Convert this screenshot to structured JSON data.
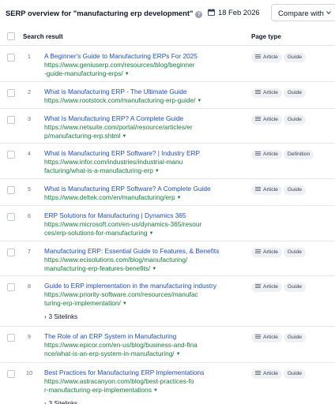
{
  "header": {
    "title": "SERP overview for \"manufacturing erp development\"",
    "date": "18 Feb 2026",
    "compare_label": "Compare with"
  },
  "table": {
    "col_result": "Search result",
    "col_pagetype": "Page type"
  },
  "sitelinks_label": "3 Sitelinks",
  "rows": [
    {
      "rank": "1",
      "title": "A Beginner's Guide to Manufacturing ERPs For 2025",
      "url": "https://www.geniuserp.com/resources/blog/beginner-guide-manufacturing-erps/",
      "tags": [
        "Article",
        "Guide"
      ]
    },
    {
      "rank": "2",
      "title": "What is Manufacturing ERP - The Ultimate Guide",
      "url": "https://www.rootstock.com/manufacturing-erp-guide/",
      "tags": [
        "Article",
        "Guide"
      ]
    },
    {
      "rank": "3",
      "title": "What Is Manufacturing ERP? A Complete Guide",
      "url": "https://www.netsuite.com/portal/resource/articles/erp/manufacturing-erp.shtml",
      "tags": [
        "Article",
        "Guide"
      ]
    },
    {
      "rank": "4",
      "title": "What is Manufacturing ERP Software? | Industry ERP",
      "url": "https://www.infor.com/industries/industrial-manufacturing/what-is-a-manufacturing-erp",
      "tags": [
        "Article",
        "Definition"
      ]
    },
    {
      "rank": "5",
      "title": "What is Manufacturing ERP Software? A Complete Guide",
      "url": "https://www.deltek.com/en/manufacturing/erp",
      "tags": [
        "Article",
        "Guide"
      ]
    },
    {
      "rank": "6",
      "title": "ERP Solutions for Manufacturing | Dynamics 365",
      "url": "https://www.microsoft.com/en-us/dynamics-365/resources/erp-solutions-for-manufacturing",
      "tags": []
    },
    {
      "rank": "7",
      "title": "Manufacturing ERP: Essential Guide to Features, & Benefits",
      "url": "https://www.ecisolutions.com/blog/manufacturing/manufacturing-erp-features-benefits/",
      "tags": [
        "Article",
        "Guide"
      ]
    },
    {
      "rank": "8",
      "title": "Guide to ERP implementation in the manufacturing industry",
      "url": "https://www.priority-software.com/resources/manufacturing-erp-implementation/",
      "tags": [
        "Article",
        "Guide"
      ]
    },
    {
      "rank": "9",
      "title": "The Role of an ERP System in Manufacturing",
      "url": "https://www.epicor.com/en-us/blog/business-and-finance/what-is-an-erp-system-in-manufacturing/",
      "tags": [
        "Article",
        "Guide"
      ]
    },
    {
      "rank": "10",
      "title": "Best Practices for Manufacturing ERP Implementations",
      "url": "https://www.astracanyon.com/blog/best-practices-for-manufacturing-erp-implementations",
      "tags": [
        "Article",
        "Guide"
      ]
    }
  ]
}
